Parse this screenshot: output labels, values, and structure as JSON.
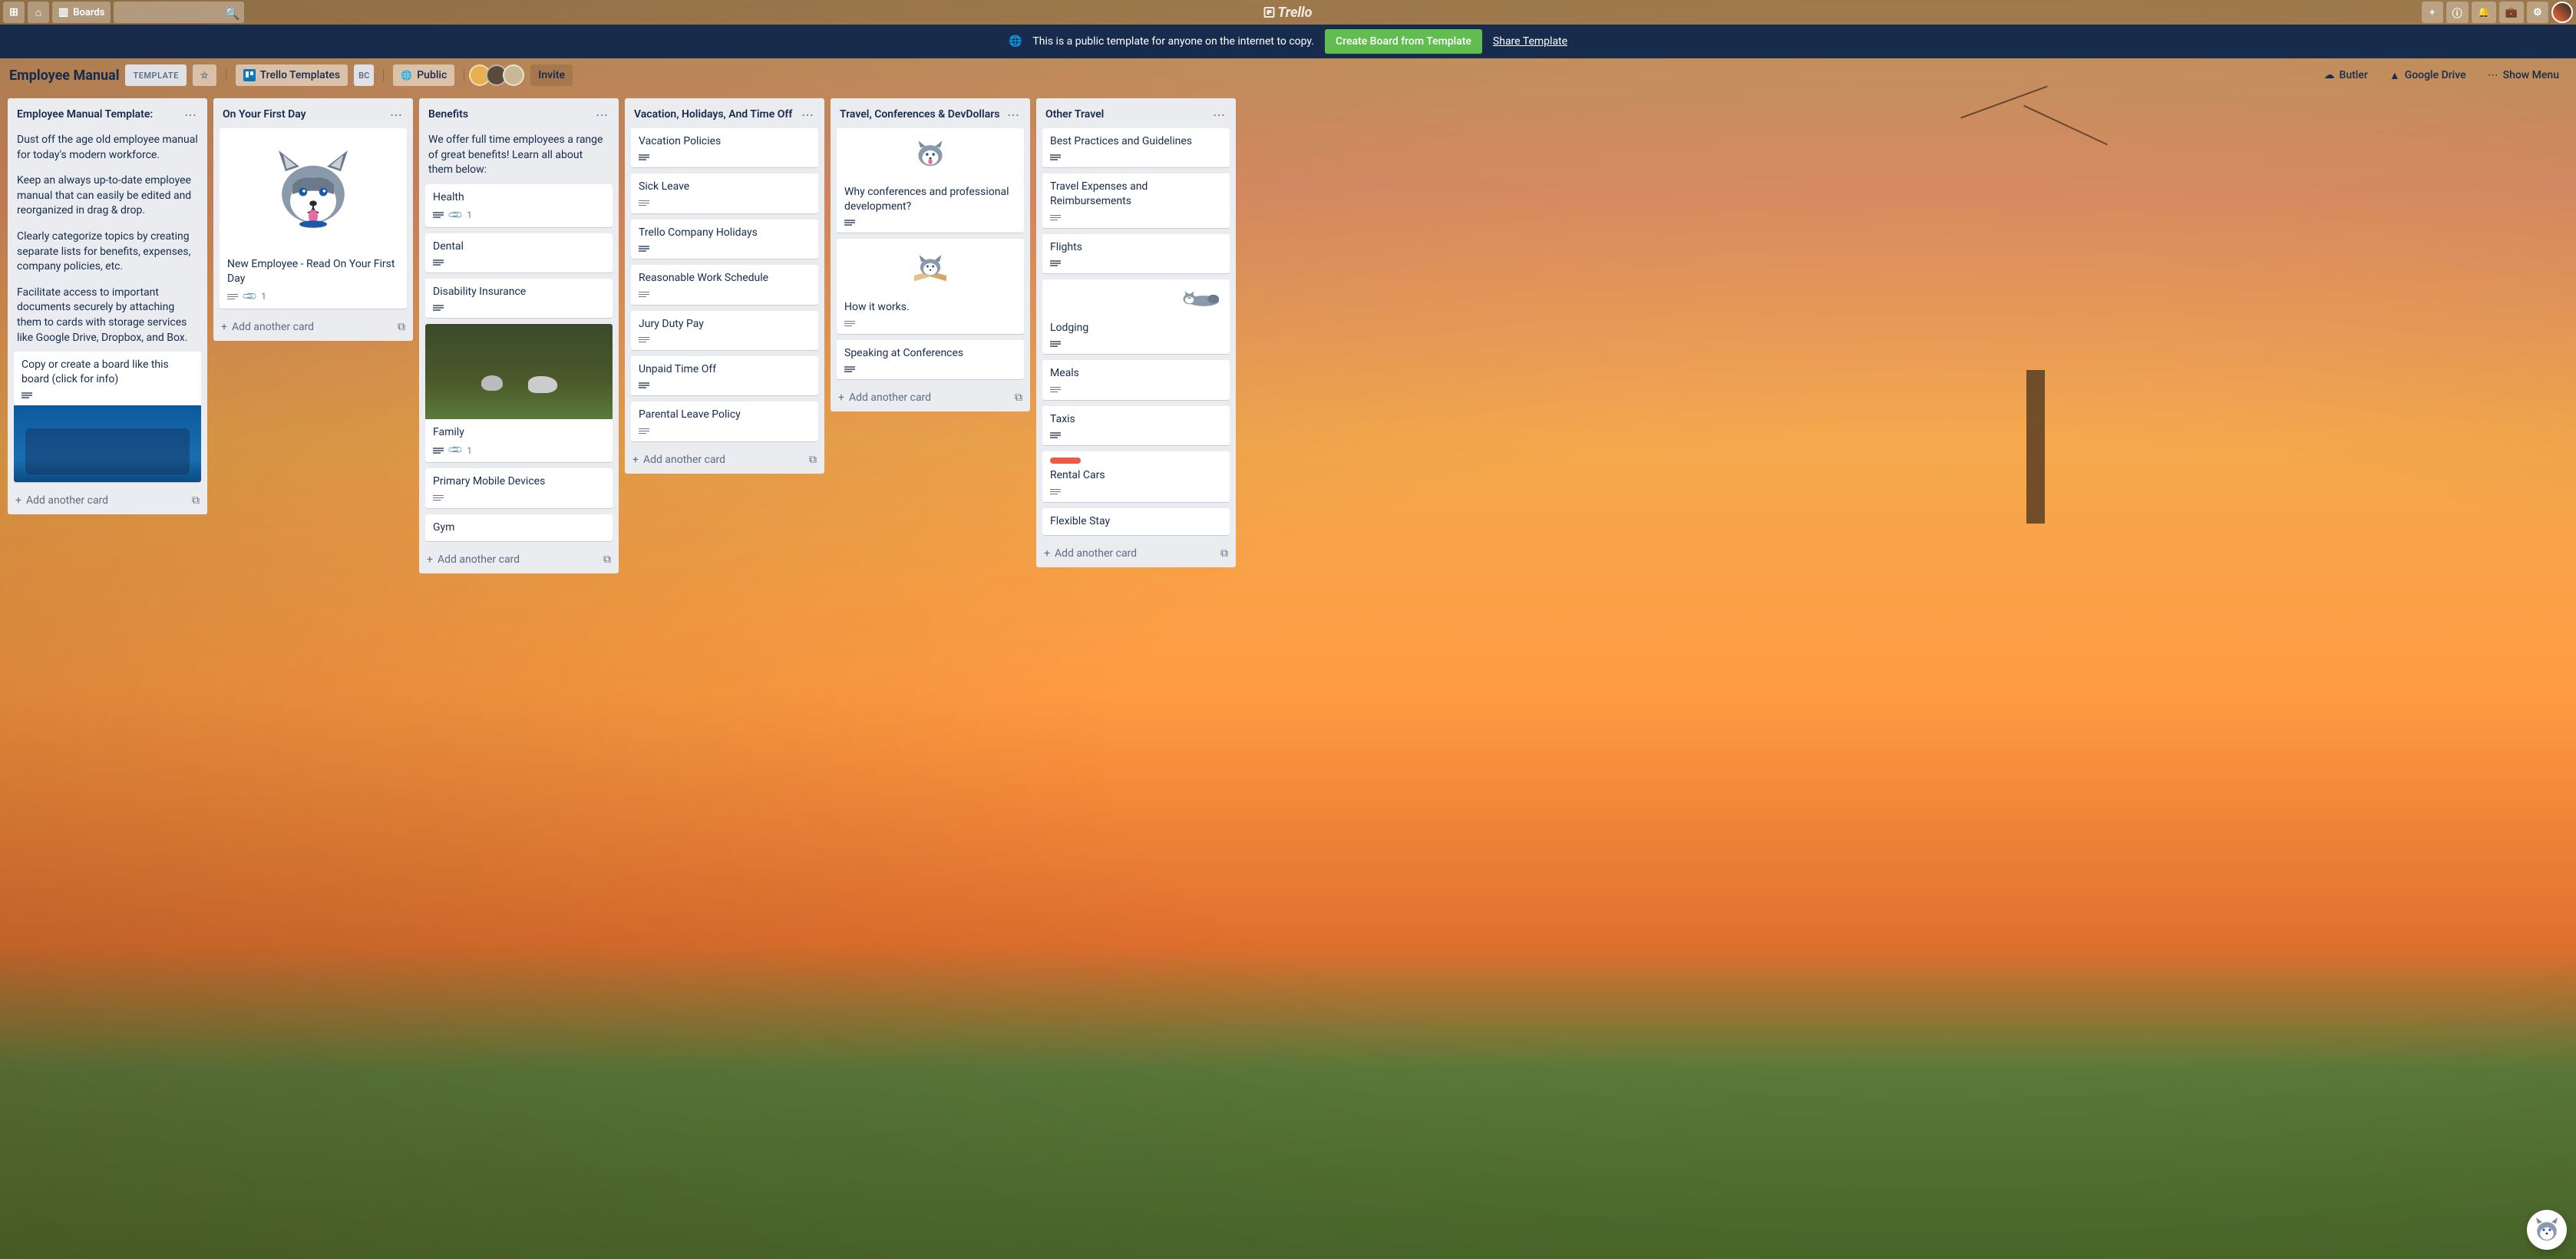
{
  "header": {
    "boards_label": "Boards",
    "logo_text": "Trello"
  },
  "banner": {
    "text": "This is a public template for anyone on the internet to copy.",
    "create_button": "Create Board from Template",
    "share_link": "Share Template"
  },
  "board_header": {
    "title": "Employee Manual",
    "template_badge": "TEMPLATE",
    "workspace": "Trello Templates",
    "workspace_badge": "BC",
    "visibility": "Public",
    "invite": "Invite",
    "butler": "Butler",
    "google_drive": "Google Drive",
    "show_menu": "Show Menu"
  },
  "lists": [
    {
      "title": "Employee Manual Template:",
      "intro_texts": [
        "Dust off the age old employee manual for today's modern workforce.",
        "Keep an always up-to-date employee manual that can easily be edited and reorganized in drag & drop.",
        "Clearly categorize topics by creating separate lists for benefits, expenses, company policies, etc.",
        "Facilitate access to important documents securely by attaching them to cards with storage services like Google Drive, Dropbox, and Box."
      ],
      "cards": [
        {
          "title": "Copy or create a board like this board (click for info)",
          "desc": true,
          "cover": "beach"
        }
      ],
      "add": "Add another card"
    },
    {
      "title": "On Your First Day",
      "cards": [
        {
          "title": "New Employee - Read On Your First Day",
          "desc": true,
          "attach": "1",
          "cover": "husky-face"
        }
      ],
      "add": "Add another card"
    },
    {
      "title": "Benefits",
      "intro_texts": [
        "We offer full time employees a range of great benefits! Learn all about them below:"
      ],
      "cards": [
        {
          "title": "Health",
          "desc": true,
          "attach": "1"
        },
        {
          "title": "Dental",
          "desc": true
        },
        {
          "title": "Disability Insurance",
          "desc": true
        },
        {
          "title": "Family",
          "desc": true,
          "attach": "1",
          "cover": "park"
        },
        {
          "title": "Primary Mobile Devices",
          "desc": true
        },
        {
          "title": "Gym"
        }
      ],
      "add": "Add another card"
    },
    {
      "title": "Vacation, Holidays, And Time Off",
      "cards": [
        {
          "title": "Vacation Policies",
          "desc": true
        },
        {
          "title": "Sick Leave",
          "desc": true
        },
        {
          "title": "Trello Company Holidays",
          "desc": true
        },
        {
          "title": "Reasonable Work Schedule",
          "desc": true
        },
        {
          "title": "Jury Duty Pay",
          "desc": true
        },
        {
          "title": "Unpaid Time Off",
          "desc": true
        },
        {
          "title": "Parental Leave Policy",
          "desc": true
        }
      ],
      "add": "Add another card"
    },
    {
      "title": "Travel, Conferences & DevDollars",
      "cards": [
        {
          "title": "Why conferences and professional development?",
          "desc": true,
          "cover": "husky-sm"
        },
        {
          "title": "How it works.",
          "desc": true,
          "cover": "husky-book"
        },
        {
          "title": "Speaking at Conferences",
          "desc": true
        }
      ],
      "add": "Add another card"
    },
    {
      "title": "Other Travel",
      "cards": [
        {
          "title": "Best Practices and Guidelines",
          "desc": true
        },
        {
          "title": "Travel Expenses and Reimbursements",
          "desc": true
        },
        {
          "title": "Flights",
          "desc": true
        },
        {
          "title": "Lodging",
          "desc": true,
          "cover": "sleeping"
        },
        {
          "title": "Meals",
          "desc": true
        },
        {
          "title": "Taxis",
          "desc": true
        },
        {
          "title": "Rental Cars",
          "desc": true,
          "label": "red"
        },
        {
          "title": "Flexible Stay"
        }
      ],
      "add": "Add another card"
    }
  ]
}
